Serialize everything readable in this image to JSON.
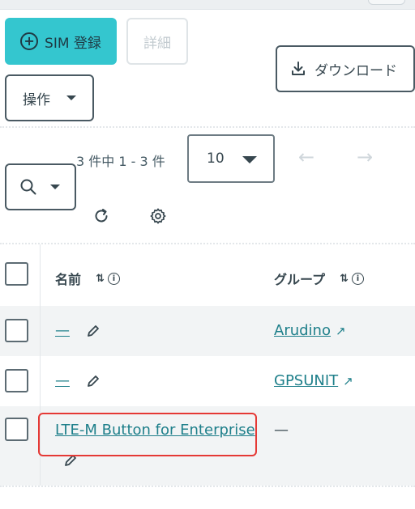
{
  "toolbar": {
    "register_label": "SIM 登録",
    "details_label": "詳細",
    "download_label": "ダウンロード",
    "operations_label": "操作"
  },
  "pagination": {
    "range_text": "3 件中 1 - 3 件",
    "per_page": "10",
    "prev_arrow": "←",
    "next_arrow": "→"
  },
  "table": {
    "columns": [
      {
        "label": "名前"
      },
      {
        "label": "グループ"
      }
    ],
    "rows": [
      {
        "name": "—",
        "group": "Arudino"
      },
      {
        "name": "—",
        "group": "GPSUNIT"
      },
      {
        "name": "LTE-M Button for Enterprise",
        "group": "—"
      }
    ]
  },
  "icons": {
    "sort": "⇅",
    "info": "i",
    "external": "↗"
  },
  "colors": {
    "primary": "#34c6cf",
    "link": "#1e7f8a",
    "highlight": "#e53935"
  }
}
